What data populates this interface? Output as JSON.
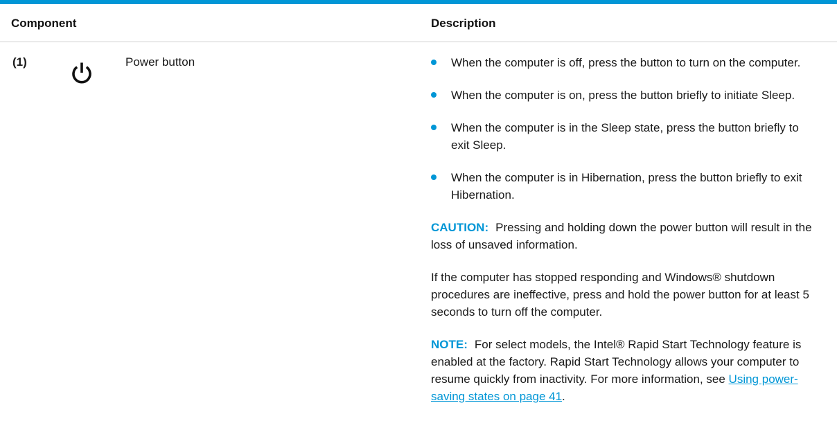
{
  "header": {
    "component_label": "Component",
    "description_label": "Description"
  },
  "row": {
    "number": "(1)",
    "icon": "power-icon",
    "name": "Power button",
    "bullets": [
      "When the computer is off, press the button to turn on the computer.",
      "When the computer is on, press the button briefly to initiate Sleep.",
      "When the computer is in the Sleep state, press the button briefly to exit Sleep.",
      "When the computer is in Hibernation, press the button briefly to exit Hibernation."
    ],
    "caution_label": "CAUTION:",
    "caution_text": "Pressing and holding down the power button will result in the loss of unsaved information.",
    "shutdown_text": "If the computer has stopped responding and Windows® shutdown procedures are ineffective, press and hold the power button for at least 5 seconds to turn off the computer.",
    "note_label": "NOTE:",
    "note_text": "For select models, the Intel® Rapid Start Technology feature is enabled at the factory. Rapid Start Technology allows your computer to resume quickly from inactivity. For more information, see ",
    "note_link": "Using power-saving states on page 41",
    "note_end": "."
  },
  "colors": {
    "accent": "#0096d6",
    "text": "#1a1a1a",
    "divider": "#cfcfcf"
  }
}
